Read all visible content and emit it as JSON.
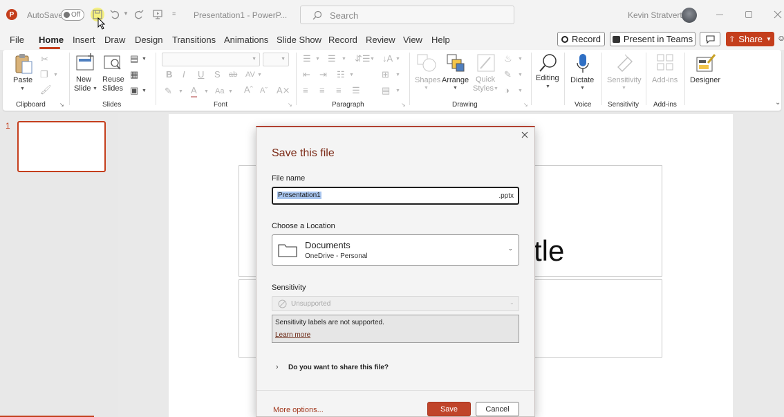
{
  "window": {
    "app_letter": "P",
    "autosave_label": "AutoSave",
    "autosave_state": "Off",
    "doc_title": "Presentation1 - PowerP...",
    "search_placeholder": "Search",
    "user_name": "Kevin Stratvert"
  },
  "tabs": [
    "File",
    "Home",
    "Insert",
    "Draw",
    "Design",
    "Transitions",
    "Animations",
    "Slide Show",
    "Record",
    "Review",
    "View",
    "Help"
  ],
  "tab_buttons": {
    "record": "Record",
    "present": "Present in Teams",
    "share": "Share"
  },
  "ribbon": {
    "groups": {
      "clipboard": "Clipboard",
      "slides": "Slides",
      "font": "Font",
      "paragraph": "Paragraph",
      "drawing": "Drawing",
      "voice": "Voice",
      "sensitivity": "Sensitivity",
      "addins": "Add-ins"
    },
    "buttons": {
      "paste": "Paste",
      "new_slide_1": "New",
      "new_slide_2": "Slide",
      "reuse_1": "Reuse",
      "reuse_2": "Slides",
      "shapes": "Shapes",
      "arrange": "Arrange",
      "quick_1": "Quick",
      "quick_2": "Styles",
      "editing": "Editing",
      "dictate": "Dictate",
      "sensitivity": "Sensitivity",
      "addins": "Add-ins",
      "designer": "Designer"
    }
  },
  "slide_panel": {
    "slide_number": "1"
  },
  "slide": {
    "title_fragment": "tle"
  },
  "dialog": {
    "title": "Save this file",
    "file_name_label": "File name",
    "file_name_value": "Presentation1",
    "file_ext": ".pptx",
    "location_label": "Choose a Location",
    "location_name": "Documents",
    "location_sub": "OneDrive - Personal",
    "sensitivity_label": "Sensitivity",
    "sensitivity_value": "Unsupported",
    "sensitivity_msg": "Sensitivity labels are not supported.",
    "learn_more": "Learn more",
    "share_question": "Do you want to share this file?",
    "more_options": "More options...",
    "save": "Save",
    "cancel": "Cancel"
  },
  "colors": {
    "accent": "#c43e1c",
    "save_button": "#c0442a",
    "link": "#a33a1f",
    "record_red": "#c43e1c"
  },
  "icons": [
    "powerpoint-logo-icon",
    "save-icon",
    "undo-icon",
    "redo-icon",
    "start-presentation-icon",
    "search-icon",
    "close-icon",
    "folder-icon",
    "shield-icon",
    "chevron-down-icon",
    "chevron-right-icon",
    "microphone-icon",
    "magnifier-icon",
    "designer-icon",
    "comment-icon"
  ]
}
